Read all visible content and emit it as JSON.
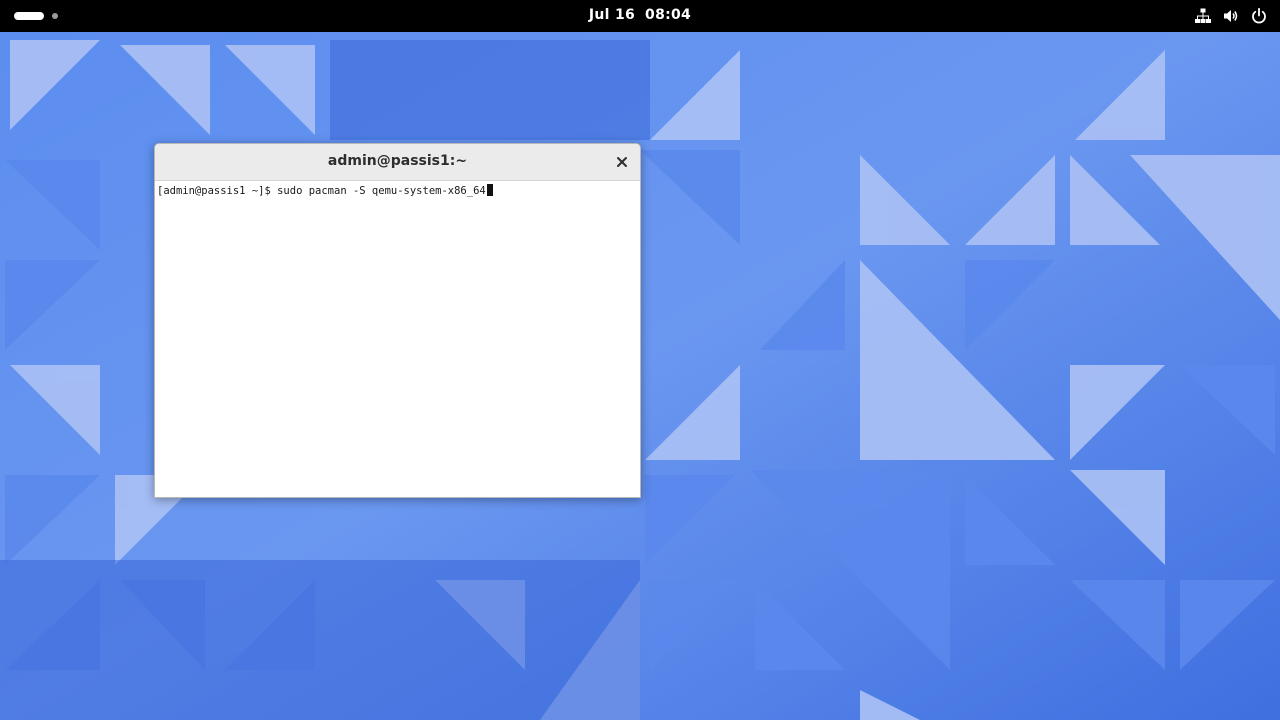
{
  "topbar": {
    "clock_date": "Jul 16",
    "clock_time": "08:04",
    "icons": [
      "network-wired-icon",
      "volume-icon",
      "power-icon"
    ]
  },
  "terminal": {
    "title": "admin@passis1:~",
    "prompt": "[admin@passis1 ~]$ ",
    "command": "sudo pacman -S qemu-system-x86_64",
    "close_icon": "close-icon"
  },
  "colors": {
    "wallpaper_base": "#4f7fe6",
    "wallpaper_light": "#a9c0f5",
    "topbar": "#000000",
    "window_header": "#ebebeb",
    "window_body": "#ffffff"
  }
}
